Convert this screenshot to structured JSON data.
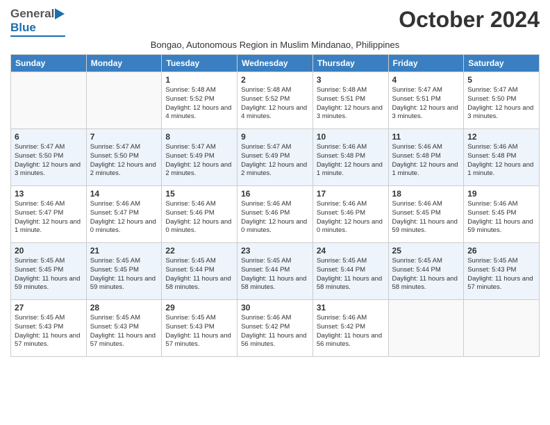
{
  "header": {
    "logo_general": "General",
    "logo_blue": "Blue",
    "month_title": "October 2024",
    "subtitle": "Bongao, Autonomous Region in Muslim Mindanao, Philippines"
  },
  "days_of_week": [
    "Sunday",
    "Monday",
    "Tuesday",
    "Wednesday",
    "Thursday",
    "Friday",
    "Saturday"
  ],
  "weeks": [
    [
      {
        "day": "",
        "info": ""
      },
      {
        "day": "",
        "info": ""
      },
      {
        "day": "1",
        "info": "Sunrise: 5:48 AM\nSunset: 5:52 PM\nDaylight: 12 hours and 4 minutes."
      },
      {
        "day": "2",
        "info": "Sunrise: 5:48 AM\nSunset: 5:52 PM\nDaylight: 12 hours and 4 minutes."
      },
      {
        "day": "3",
        "info": "Sunrise: 5:48 AM\nSunset: 5:51 PM\nDaylight: 12 hours and 3 minutes."
      },
      {
        "day": "4",
        "info": "Sunrise: 5:47 AM\nSunset: 5:51 PM\nDaylight: 12 hours and 3 minutes."
      },
      {
        "day": "5",
        "info": "Sunrise: 5:47 AM\nSunset: 5:50 PM\nDaylight: 12 hours and 3 minutes."
      }
    ],
    [
      {
        "day": "6",
        "info": "Sunrise: 5:47 AM\nSunset: 5:50 PM\nDaylight: 12 hours and 3 minutes."
      },
      {
        "day": "7",
        "info": "Sunrise: 5:47 AM\nSunset: 5:50 PM\nDaylight: 12 hours and 2 minutes."
      },
      {
        "day": "8",
        "info": "Sunrise: 5:47 AM\nSunset: 5:49 PM\nDaylight: 12 hours and 2 minutes."
      },
      {
        "day": "9",
        "info": "Sunrise: 5:47 AM\nSunset: 5:49 PM\nDaylight: 12 hours and 2 minutes."
      },
      {
        "day": "10",
        "info": "Sunrise: 5:46 AM\nSunset: 5:48 PM\nDaylight: 12 hours and 1 minute."
      },
      {
        "day": "11",
        "info": "Sunrise: 5:46 AM\nSunset: 5:48 PM\nDaylight: 12 hours and 1 minute."
      },
      {
        "day": "12",
        "info": "Sunrise: 5:46 AM\nSunset: 5:48 PM\nDaylight: 12 hours and 1 minute."
      }
    ],
    [
      {
        "day": "13",
        "info": "Sunrise: 5:46 AM\nSunset: 5:47 PM\nDaylight: 12 hours and 1 minute."
      },
      {
        "day": "14",
        "info": "Sunrise: 5:46 AM\nSunset: 5:47 PM\nDaylight: 12 hours and 0 minutes."
      },
      {
        "day": "15",
        "info": "Sunrise: 5:46 AM\nSunset: 5:46 PM\nDaylight: 12 hours and 0 minutes."
      },
      {
        "day": "16",
        "info": "Sunrise: 5:46 AM\nSunset: 5:46 PM\nDaylight: 12 hours and 0 minutes."
      },
      {
        "day": "17",
        "info": "Sunrise: 5:46 AM\nSunset: 5:46 PM\nDaylight: 12 hours and 0 minutes."
      },
      {
        "day": "18",
        "info": "Sunrise: 5:46 AM\nSunset: 5:45 PM\nDaylight: 11 hours and 59 minutes."
      },
      {
        "day": "19",
        "info": "Sunrise: 5:46 AM\nSunset: 5:45 PM\nDaylight: 11 hours and 59 minutes."
      }
    ],
    [
      {
        "day": "20",
        "info": "Sunrise: 5:45 AM\nSunset: 5:45 PM\nDaylight: 11 hours and 59 minutes."
      },
      {
        "day": "21",
        "info": "Sunrise: 5:45 AM\nSunset: 5:45 PM\nDaylight: 11 hours and 59 minutes."
      },
      {
        "day": "22",
        "info": "Sunrise: 5:45 AM\nSunset: 5:44 PM\nDaylight: 11 hours and 58 minutes."
      },
      {
        "day": "23",
        "info": "Sunrise: 5:45 AM\nSunset: 5:44 PM\nDaylight: 11 hours and 58 minutes."
      },
      {
        "day": "24",
        "info": "Sunrise: 5:45 AM\nSunset: 5:44 PM\nDaylight: 11 hours and 58 minutes."
      },
      {
        "day": "25",
        "info": "Sunrise: 5:45 AM\nSunset: 5:44 PM\nDaylight: 11 hours and 58 minutes."
      },
      {
        "day": "26",
        "info": "Sunrise: 5:45 AM\nSunset: 5:43 PM\nDaylight: 11 hours and 57 minutes."
      }
    ],
    [
      {
        "day": "27",
        "info": "Sunrise: 5:45 AM\nSunset: 5:43 PM\nDaylight: 11 hours and 57 minutes."
      },
      {
        "day": "28",
        "info": "Sunrise: 5:45 AM\nSunset: 5:43 PM\nDaylight: 11 hours and 57 minutes."
      },
      {
        "day": "29",
        "info": "Sunrise: 5:45 AM\nSunset: 5:43 PM\nDaylight: 11 hours and 57 minutes."
      },
      {
        "day": "30",
        "info": "Sunrise: 5:46 AM\nSunset: 5:42 PM\nDaylight: 11 hours and 56 minutes."
      },
      {
        "day": "31",
        "info": "Sunrise: 5:46 AM\nSunset: 5:42 PM\nDaylight: 11 hours and 56 minutes."
      },
      {
        "day": "",
        "info": ""
      },
      {
        "day": "",
        "info": ""
      }
    ]
  ]
}
